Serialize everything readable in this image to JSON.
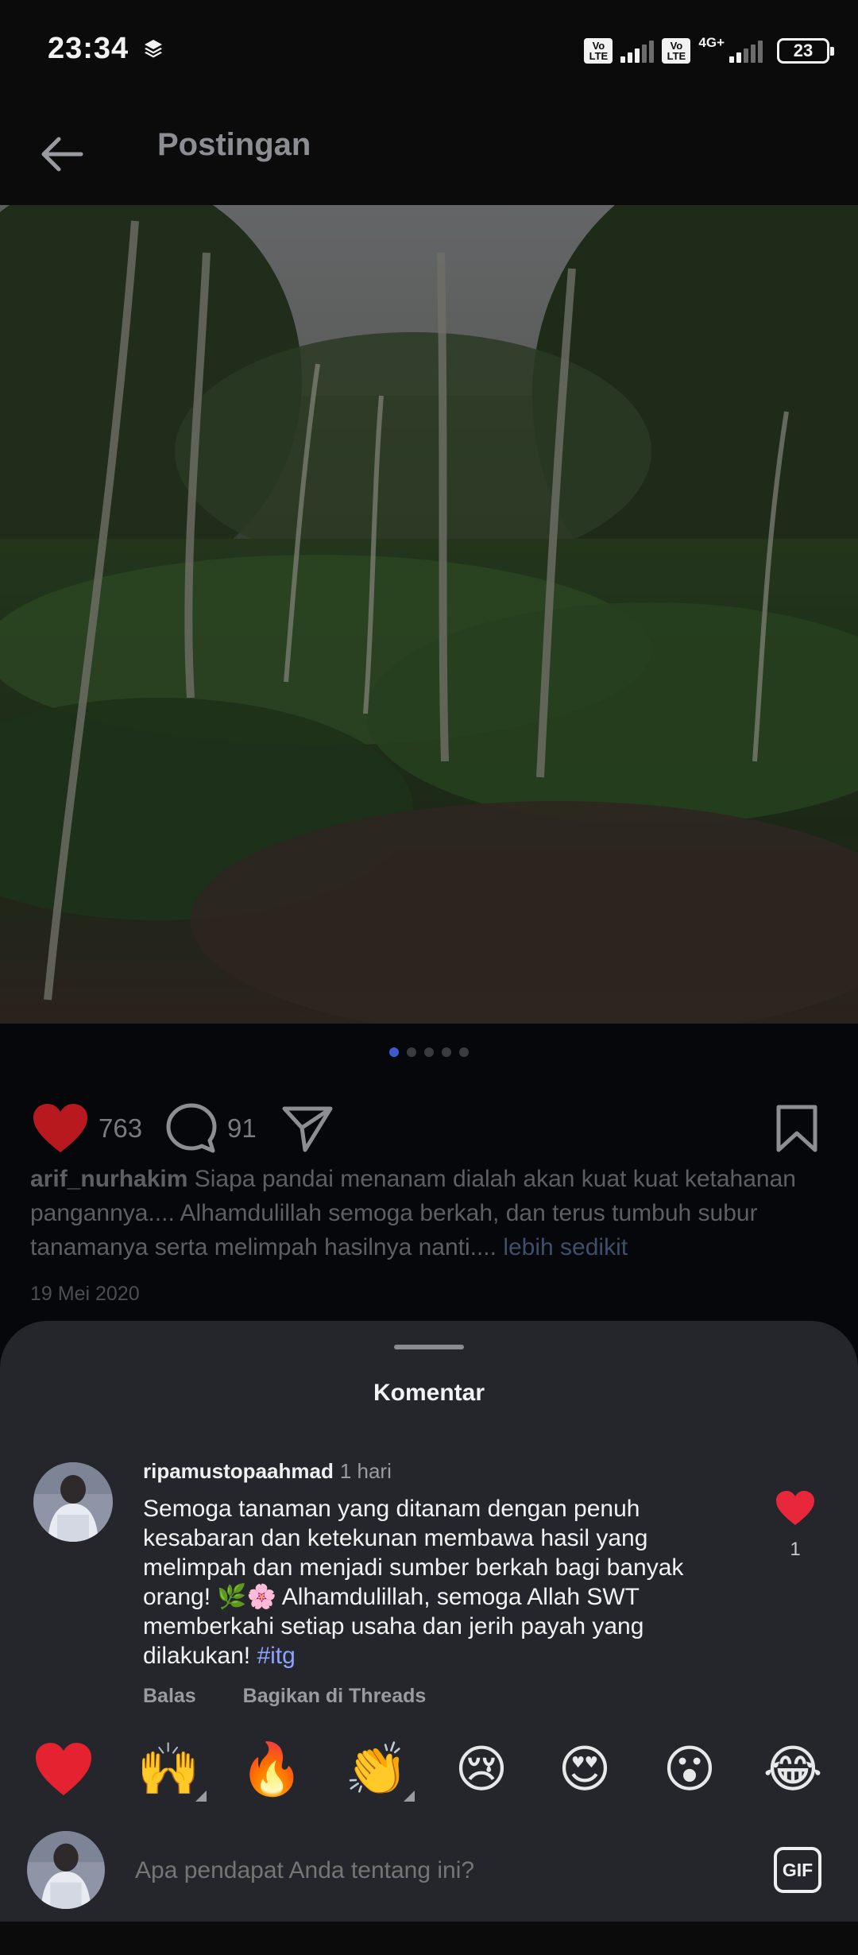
{
  "status_bar": {
    "time": "23:34",
    "volte_label": "Vo LTE",
    "network": "4G+",
    "battery": "23"
  },
  "header": {
    "title": "Postingan",
    "back_icon": "arrow-left-icon"
  },
  "carousel": {
    "total_slides": 5,
    "active_slide": 1
  },
  "actions": {
    "likes": "763",
    "comments": "91",
    "like_color": "#b8191f",
    "icons": [
      "heart-icon",
      "comment-icon",
      "share-icon",
      "bookmark-icon"
    ]
  },
  "caption": {
    "username": "arif_nurhakim",
    "text": "Siapa pandai menanam dialah akan kuat kuat ketahanan pangannya.... Alhamdulillah semoga berkah, dan terus tumbuh subur tanamanya serta melimpah hasilnya nanti....",
    "more": "lebih sedikit",
    "date": "19 Mei 2020"
  },
  "comments_sheet": {
    "title": "Komentar",
    "comment": {
      "username": "ripamustopaahmad",
      "time": "1 hari",
      "text": "Semoga tanaman yang ditanam dengan penuh kesabaran dan ketekunan membawa hasil yang melimpah dan menjadi sumber berkah bagi banyak orang! 🌿🌸 Alhamdulillah, semoga Allah SWT memberkahi setiap usaha dan jerih payah yang dilakukan!",
      "hashtag": "#itg",
      "like_count": "1",
      "reply": "Balas",
      "share": "Bagikan di Threads"
    },
    "reactions": [
      "❤️",
      "🙌",
      "🔥",
      "👏",
      "😢",
      "😍",
      "😮",
      "😂"
    ],
    "composer": {
      "placeholder": "Apa pendapat Anda tentang ini?",
      "gif_label": "GIF"
    }
  }
}
